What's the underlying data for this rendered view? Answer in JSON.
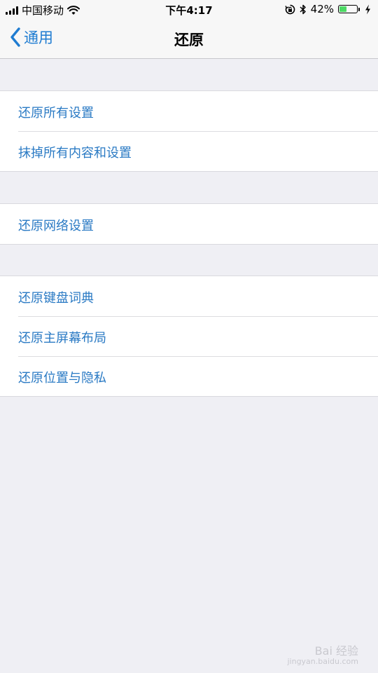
{
  "status_bar": {
    "carrier": "中国移动",
    "time": "下午4:17",
    "battery_percent": "42%",
    "battery_level": 0.42,
    "icons": [
      "signal-icon",
      "wifi-icon",
      "rotation-lock-icon",
      "bluetooth-icon",
      "battery-icon",
      "charging-icon"
    ]
  },
  "nav": {
    "back_label": "通用",
    "title": "还原"
  },
  "groups": [
    {
      "items": [
        {
          "label": "还原所有设置"
        },
        {
          "label": "抹掉所有内容和设置"
        }
      ]
    },
    {
      "items": [
        {
          "label": "还原网络设置"
        }
      ]
    },
    {
      "items": [
        {
          "label": "还原键盘词典"
        },
        {
          "label": "还原主屏幕布局"
        },
        {
          "label": "还原位置与隐私"
        }
      ]
    }
  ],
  "watermark": {
    "text": "Bai 经验",
    "subtext": "jingyan.baidu.com"
  },
  "colors": {
    "accent": "#1f7cd1",
    "row_text": "#2a7ac4",
    "background": "#efeff4",
    "battery_fill": "#4cd964"
  }
}
